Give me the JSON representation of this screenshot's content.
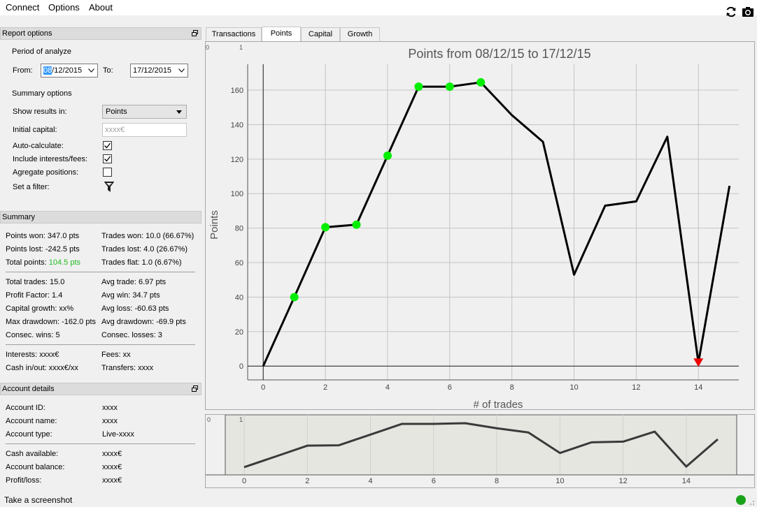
{
  "menu": {
    "items": [
      "Connect",
      "Options",
      "About"
    ]
  },
  "toolbar": {
    "refresh_icon": "refresh-icon",
    "screenshot_icon": "camera-icon"
  },
  "report_options": {
    "title": "Report options",
    "period_label": "Period of analyze",
    "from_label": "From:",
    "from_value_selected": "08",
    "from_value_rest": "/12/2015",
    "to_label": "To:",
    "to_value": "17/12/2015",
    "summary_options_label": "Summary options",
    "show_results_label": "Show results in:",
    "show_results_value": "Points",
    "initial_capital_label": "Initial capital:",
    "initial_capital_placeholder": "xxxx€",
    "auto_calc_label": "Auto-calculate:",
    "auto_calc_checked": true,
    "include_fees_label": "Include interests/fees:",
    "include_fees_checked": true,
    "aggregate_label": "Agregate positions:",
    "aggregate_checked": false,
    "filter_label": "Set a filter:"
  },
  "summary": {
    "title": "Summary",
    "points_won": "Points won: 347.0 pts",
    "trades_won": "Trades won: 10.0 (66.67%)",
    "points_lost": "Points lost: -242.5 pts",
    "trades_lost": "Trades lost: 4.0 (26.67%)",
    "total_points_label": "Total points: ",
    "total_points_value": "104.5 pts",
    "trades_flat": "Trades flat: 1.0 (6.67%)",
    "total_trades": "Total trades: 15.0",
    "avg_trade": "Avg trade: 6.97 pts",
    "profit_factor": "Profit Factor: 1.4",
    "avg_win": "Avg win: 34.7 pts",
    "capital_growth": "Capital growth: xx%",
    "avg_loss": "Avg loss: -60.63 pts",
    "max_drawdown": "Max drawdown: -162.0 pts",
    "avg_drawdown": "Avg drawdown: -69.9 pts",
    "consec_wins": "Consec. wins: 5",
    "consec_losses": "Consec. losses: 3",
    "interests": "Interests: xxxx€",
    "fees": "Fees: xx",
    "cash_inout": "Cash in/out: xxxx€/xx",
    "transfers": "Transfers: xxxx",
    "total_points_color": "#22bb22"
  },
  "account": {
    "title": "Account details",
    "id_label": "Account ID:",
    "id_value": "xxxx",
    "name_label": "Account name:",
    "name_value": "xxxx",
    "type_label": "Account type:",
    "type_value": "Live-xxxx",
    "cash_label": "Cash available:",
    "cash_value": "xxxx€",
    "balance_label": "Account balance:",
    "balance_value": "xxxx€",
    "pl_label": "Profit/loss:",
    "pl_value": "xxxx€"
  },
  "tabs": [
    "Transactions",
    "Points",
    "Capital",
    "Growth"
  ],
  "active_tab": "Points",
  "status": {
    "text": "Take a screenshot",
    "dot_color": "#1aa31a"
  },
  "chart_data": {
    "type": "line",
    "title": "Points from 08/12/15 to 17/12/15",
    "xlabel": "# of trades",
    "ylabel": "Points",
    "x": [
      0,
      1,
      2,
      3,
      4,
      5,
      6,
      7,
      8,
      9,
      10,
      11,
      12,
      13,
      14,
      15
    ],
    "y": [
      0,
      40,
      80.5,
      82,
      122,
      162,
      162,
      164.5,
      145.5,
      130,
      53,
      93,
      95.5,
      133,
      2,
      104.5
    ],
    "xlim": [
      -0.5,
      15.3
    ],
    "ylim": [
      -8,
      175
    ],
    "xticks": [
      0,
      2,
      4,
      6,
      8,
      10,
      12,
      14
    ],
    "yticks": [
      0,
      20,
      40,
      60,
      80,
      100,
      120,
      140,
      160
    ],
    "marker_green_indices": [
      1,
      2,
      3,
      4,
      5,
      6,
      7
    ],
    "marker_red_indices": [
      14
    ],
    "grid": true,
    "line_color": "#000000",
    "win_marker_color": "#00ee00",
    "loss_marker_color": "#ee0000",
    "corner_labels": [
      "0",
      "1"
    ]
  },
  "overview_chart": {
    "xticks": [
      0,
      2,
      4,
      6,
      8,
      10,
      12,
      14
    ],
    "corner_labels": [
      "0",
      "1"
    ],
    "line_color": "#3a3a3a"
  }
}
